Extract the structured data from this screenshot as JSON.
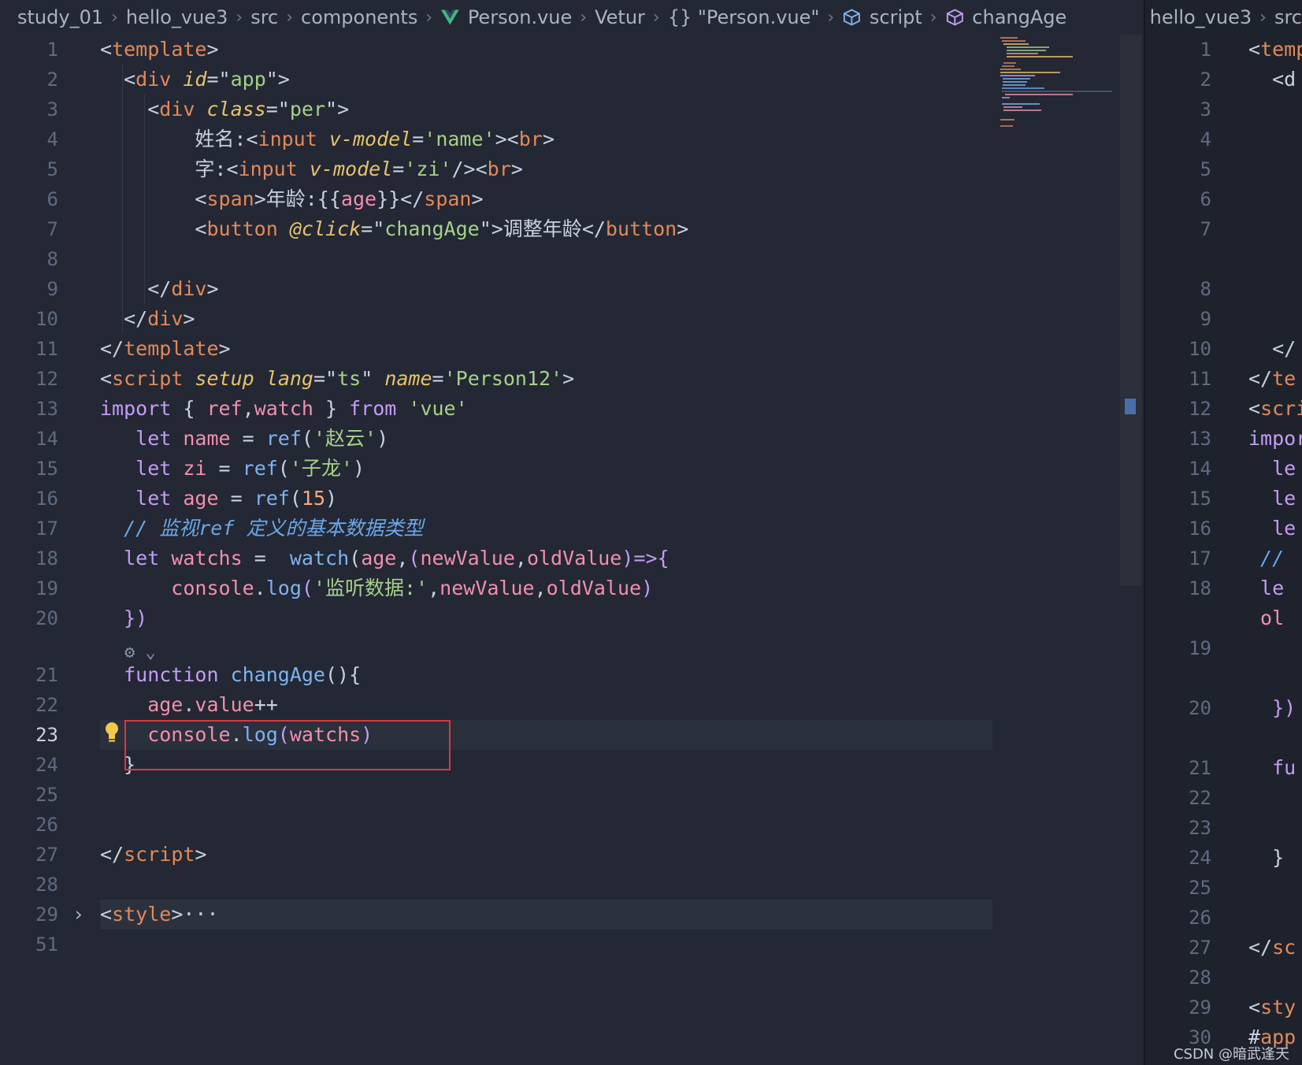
{
  "breadcrumb": {
    "items": [
      "study_01",
      "hello_vue3",
      "src",
      "components",
      "Person.vue",
      "Vetur",
      "{} \"Person.vue\"",
      "script",
      "changAge"
    ]
  },
  "editor_left": {
    "lines": [
      {
        "n": "1",
        "seg": [
          [
            "br",
            "<"
          ],
          [
            "tag",
            "template"
          ],
          [
            "br",
            ">"
          ]
        ]
      },
      {
        "n": "2",
        "seg": [
          [
            "br",
            "  <"
          ],
          [
            "tag",
            "div"
          ],
          [
            "br",
            " "
          ],
          [
            "attr",
            "id"
          ],
          [
            "br",
            "=\""
          ],
          [
            "str",
            "app"
          ],
          [
            "br",
            "\">"
          ]
        ]
      },
      {
        "n": "3",
        "seg": [
          [
            "br",
            "    <"
          ],
          [
            "tag",
            "div"
          ],
          [
            "br",
            " "
          ],
          [
            "attr",
            "class"
          ],
          [
            "br",
            "=\""
          ],
          [
            "str",
            "per"
          ],
          [
            "br",
            "\">"
          ]
        ]
      },
      {
        "n": "4",
        "seg": [
          [
            "txtc",
            "        姓名:"
          ],
          [
            "br",
            "<"
          ],
          [
            "tag",
            "input"
          ],
          [
            "br",
            " "
          ],
          [
            "attr",
            "v-model"
          ],
          [
            "br",
            "="
          ],
          [
            "str",
            "'name'"
          ],
          [
            "br",
            "><"
          ],
          [
            "tag",
            "br"
          ],
          [
            "br",
            ">"
          ]
        ]
      },
      {
        "n": "5",
        "seg": [
          [
            "txtc",
            "        字:"
          ],
          [
            "br",
            "<"
          ],
          [
            "tag",
            "input"
          ],
          [
            "br",
            " "
          ],
          [
            "attr",
            "v-model"
          ],
          [
            "br",
            "="
          ],
          [
            "str",
            "'zi'"
          ],
          [
            "br",
            "/><"
          ],
          [
            "tag",
            "br"
          ],
          [
            "br",
            ">"
          ]
        ]
      },
      {
        "n": "6",
        "seg": [
          [
            "br",
            "        <"
          ],
          [
            "tag",
            "span"
          ],
          [
            "br",
            ">"
          ],
          [
            "txtc",
            "年龄:{{"
          ],
          [
            "var",
            "age"
          ],
          [
            "txtc",
            "}}"
          ],
          [
            "br",
            "</"
          ],
          [
            "tag",
            "span"
          ],
          [
            "br",
            ">"
          ]
        ]
      },
      {
        "n": "7",
        "seg": [
          [
            "br",
            "        <"
          ],
          [
            "tag",
            "button"
          ],
          [
            "br",
            " "
          ],
          [
            "attr",
            "@click"
          ],
          [
            "br",
            "=\""
          ],
          [
            "str",
            "changAge"
          ],
          [
            "br",
            "\">"
          ],
          [
            "txtc",
            "调整年龄"
          ],
          [
            "br",
            "</"
          ],
          [
            "tag",
            "button"
          ],
          [
            "br",
            ">"
          ]
        ]
      },
      {
        "n": "8",
        "seg": []
      },
      {
        "n": "9",
        "seg": [
          [
            "br",
            "    </"
          ],
          [
            "tag",
            "div"
          ],
          [
            "br",
            ">"
          ]
        ]
      },
      {
        "n": "10",
        "seg": [
          [
            "br",
            "  </"
          ],
          [
            "tag",
            "div"
          ],
          [
            "br",
            ">"
          ]
        ]
      },
      {
        "n": "11",
        "seg": [
          [
            "br",
            "</"
          ],
          [
            "tag",
            "template"
          ],
          [
            "br",
            ">"
          ]
        ]
      },
      {
        "n": "12",
        "seg": [
          [
            "br",
            "<"
          ],
          [
            "tag",
            "script"
          ],
          [
            "br",
            " "
          ],
          [
            "attr",
            "setup"
          ],
          [
            "br",
            " "
          ],
          [
            "attr",
            "lang"
          ],
          [
            "br",
            "=\""
          ],
          [
            "str",
            "ts"
          ],
          [
            "br",
            "\" "
          ],
          [
            "attr",
            "name"
          ],
          [
            "br",
            "="
          ],
          [
            "str",
            "'Person12'"
          ],
          [
            "br",
            ">"
          ]
        ]
      },
      {
        "n": "13",
        "seg": [
          [
            "kw",
            "import"
          ],
          [
            "br",
            " { "
          ],
          [
            "var",
            "ref"
          ],
          [
            "br",
            ","
          ],
          [
            "var",
            "watch"
          ],
          [
            "br",
            " } "
          ],
          [
            "kw",
            "from"
          ],
          [
            "br",
            " "
          ],
          [
            "str",
            "'vue'"
          ]
        ]
      },
      {
        "n": "14",
        "seg": [
          [
            "kw",
            "   let"
          ],
          [
            "br",
            " "
          ],
          [
            "var",
            "name"
          ],
          [
            "br",
            " = "
          ],
          [
            "fn",
            "ref"
          ],
          [
            "br",
            "("
          ],
          [
            "str",
            "'赵云'"
          ],
          [
            "br",
            ")"
          ]
        ]
      },
      {
        "n": "15",
        "seg": [
          [
            "kw",
            "   let"
          ],
          [
            "br",
            " "
          ],
          [
            "var",
            "zi"
          ],
          [
            "br",
            " = "
          ],
          [
            "fn",
            "ref"
          ],
          [
            "br",
            "("
          ],
          [
            "str",
            "'子龙'"
          ],
          [
            "br",
            ")"
          ]
        ]
      },
      {
        "n": "16",
        "seg": [
          [
            "kw",
            "   let"
          ],
          [
            "br",
            " "
          ],
          [
            "var",
            "age"
          ],
          [
            "br",
            " = "
          ],
          [
            "fn",
            "ref"
          ],
          [
            "br",
            "("
          ],
          [
            "num",
            "15"
          ],
          [
            "br",
            ")"
          ]
        ]
      },
      {
        "n": "17",
        "seg": [
          [
            "cm",
            "  // 监视ref 定义的基本数据类型"
          ]
        ]
      },
      {
        "n": "18",
        "seg": [
          [
            "kw",
            "  let"
          ],
          [
            "br",
            " "
          ],
          [
            "var",
            "watchs"
          ],
          [
            "br",
            " =  "
          ],
          [
            "fn",
            "watch"
          ],
          [
            "br",
            "("
          ],
          [
            "var",
            "age"
          ],
          [
            "br",
            ","
          ],
          [
            "kw",
            "("
          ],
          [
            "var",
            "newValue"
          ],
          [
            "br",
            ","
          ],
          [
            "var",
            "oldValue"
          ],
          [
            "kw",
            ")=>{"
          ]
        ]
      },
      {
        "n": "19",
        "seg": [
          [
            "var",
            "      console"
          ],
          [
            "br",
            "."
          ],
          [
            "fn",
            "log"
          ],
          [
            "kw",
            "("
          ],
          [
            "str",
            "'监听数据:'"
          ],
          [
            "br",
            ","
          ],
          [
            "var",
            "newValue"
          ],
          [
            "br",
            ","
          ],
          [
            "var",
            "oldValue"
          ],
          [
            "kw",
            ")"
          ]
        ]
      },
      {
        "n": "20",
        "seg": [
          [
            "kw",
            "  })"
          ]
        ]
      },
      {
        "n": "lens",
        "seg": []
      },
      {
        "n": "21",
        "seg": [
          [
            "kw",
            "  function"
          ],
          [
            "br",
            " "
          ],
          [
            "fn",
            "changAge"
          ],
          [
            "br",
            "(){"
          ]
        ]
      },
      {
        "n": "22",
        "seg": [
          [
            "var",
            "    age"
          ],
          [
            "br",
            "."
          ],
          [
            "var",
            "value"
          ],
          [
            "br",
            "++"
          ]
        ]
      },
      {
        "n": "23",
        "seg": [
          [
            "var",
            "    console"
          ],
          [
            "br",
            "."
          ],
          [
            "fn",
            "log"
          ],
          [
            "kw",
            "("
          ],
          [
            "var",
            "watchs"
          ],
          [
            "kw",
            ")"
          ]
        ]
      },
      {
        "n": "24",
        "seg": [
          [
            "br",
            "  }"
          ]
        ]
      },
      {
        "n": "25",
        "seg": []
      },
      {
        "n": "26",
        "seg": []
      },
      {
        "n": "27",
        "seg": [
          [
            "br",
            "</"
          ],
          [
            "tag",
            "script"
          ],
          [
            "br",
            ">"
          ]
        ]
      },
      {
        "n": "28",
        "seg": []
      },
      {
        "n": "29",
        "seg": [
          [
            "br",
            "<"
          ],
          [
            "tag",
            "style"
          ],
          [
            "br",
            ">···"
          ]
        ]
      },
      {
        "n": "51",
        "seg": []
      }
    ]
  },
  "editor_right": {
    "breadcrumb": [
      "hello_vue3",
      "src"
    ],
    "lines": [
      {
        "n": "1",
        "t": [
          [
            "br",
            "<"
          ],
          [
            "tag",
            "temp"
          ]
        ]
      },
      {
        "n": "2",
        "t": [
          [
            "br",
            "  <d"
          ]
        ]
      },
      {
        "n": "3",
        "t": []
      },
      {
        "n": "4",
        "t": []
      },
      {
        "n": "5",
        "t": []
      },
      {
        "n": "6",
        "t": []
      },
      {
        "n": "7",
        "t": []
      },
      {
        "n": "",
        "t": []
      },
      {
        "n": "8",
        "t": []
      },
      {
        "n": "9",
        "t": []
      },
      {
        "n": "10",
        "t": [
          [
            "br",
            "  </"
          ]
        ]
      },
      {
        "n": "11",
        "t": [
          [
            "br",
            "</"
          ],
          [
            "tag",
            "te"
          ]
        ]
      },
      {
        "n": "12",
        "t": [
          [
            "br",
            "<"
          ],
          [
            "tag",
            "scri"
          ]
        ]
      },
      {
        "n": "13",
        "t": [
          [
            "kw",
            "impor"
          ]
        ]
      },
      {
        "n": "14",
        "t": [
          [
            "kw",
            "  le"
          ]
        ]
      },
      {
        "n": "15",
        "t": [
          [
            "kw",
            "  le"
          ]
        ]
      },
      {
        "n": "16",
        "t": [
          [
            "kw",
            "  le"
          ]
        ]
      },
      {
        "n": "17",
        "t": [
          [
            "cm",
            " //"
          ]
        ]
      },
      {
        "n": "18",
        "t": [
          [
            "kw",
            " le"
          ]
        ]
      },
      {
        "n": "",
        "t": [
          [
            "var",
            " ol"
          ]
        ]
      },
      {
        "n": "19",
        "t": []
      },
      {
        "n": "",
        "t": []
      },
      {
        "n": "20",
        "t": [
          [
            "kw",
            "  })"
          ]
        ]
      },
      {
        "n": "",
        "t": []
      },
      {
        "n": "21",
        "t": [
          [
            "kw",
            "  fu"
          ]
        ]
      },
      {
        "n": "22",
        "t": []
      },
      {
        "n": "23",
        "t": []
      },
      {
        "n": "24",
        "t": [
          [
            "br",
            "  }"
          ]
        ]
      },
      {
        "n": "25",
        "t": []
      },
      {
        "n": "26",
        "t": []
      },
      {
        "n": "27",
        "t": [
          [
            "br",
            "</"
          ],
          [
            "tag",
            "sc"
          ]
        ]
      },
      {
        "n": "28",
        "t": []
      },
      {
        "n": "29",
        "t": [
          [
            "br",
            "<"
          ],
          [
            "tag",
            "sty"
          ]
        ]
      },
      {
        "n": "30",
        "t": [
          [
            "br",
            "#"
          ],
          [
            "tag",
            "app"
          ]
        ]
      }
    ]
  },
  "watermark": "CSDN @暗武逢天",
  "colors": {
    "highlight_box": "#e0353a",
    "bulb": "#f2c94c",
    "accent": "#4a6ea8"
  }
}
